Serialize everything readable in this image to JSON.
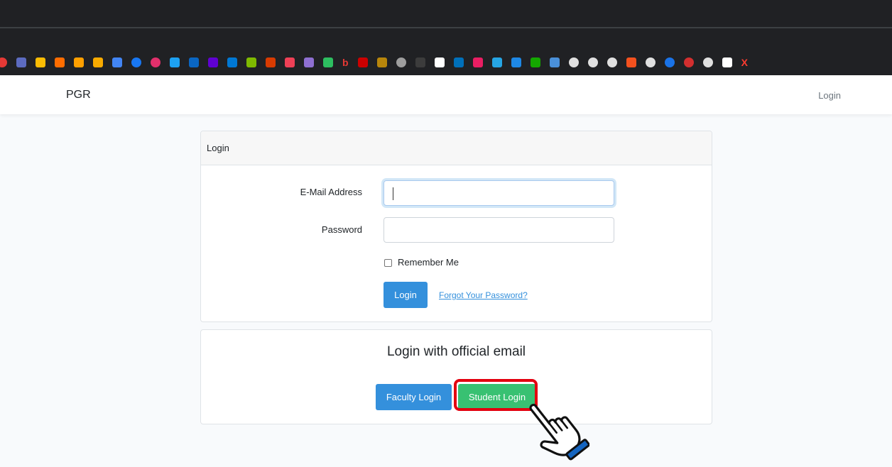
{
  "browser": {
    "bookmark_icons": [
      {
        "icon": "red-dot-icon",
        "color": "#e53935",
        "round": true
      },
      {
        "icon": "bookmark-flag-icon",
        "color": "#5c6bc0"
      },
      {
        "icon": "google-ads-icon",
        "color": "#fbbc04"
      },
      {
        "icon": "arch-icon",
        "color": "#ff6d00"
      },
      {
        "icon": "firebase-icon",
        "color": "#ffa000"
      },
      {
        "icon": "analytics-icon",
        "color": "#f9ab00"
      },
      {
        "icon": "translate-icon",
        "color": "#4285f4"
      },
      {
        "icon": "facebook-icon",
        "color": "#1877f2",
        "round": true
      },
      {
        "icon": "instagram-icon",
        "color": "#e1306c",
        "round": true
      },
      {
        "icon": "twitter-icon",
        "color": "#1da1f2"
      },
      {
        "icon": "linkedin-icon",
        "color": "#0a66c2"
      },
      {
        "icon": "yahoo-icon",
        "color": "#6001d2"
      },
      {
        "icon": "outlook-icon",
        "color": "#0078d4"
      },
      {
        "icon": "microsoft-icon",
        "color": "#7fba00"
      },
      {
        "icon": "office-icon",
        "color": "#d83b01"
      },
      {
        "icon": "pocket-icon",
        "color": "#ef4056"
      },
      {
        "icon": "notes-icon",
        "color": "#8e6fd1"
      },
      {
        "icon": "evernote-icon",
        "color": "#2dbe60"
      },
      {
        "icon": "text-b-icon",
        "color": "#e53935",
        "text": "b"
      },
      {
        "icon": "cnn-icon",
        "color": "#cc0000"
      },
      {
        "icon": "pattern-icon",
        "color": "#b8860b"
      },
      {
        "icon": "profile-icon",
        "color": "#9e9e9e",
        "round": true
      },
      {
        "icon": "drive-icon",
        "color": "#3c3c3c"
      },
      {
        "icon": "notion-icon",
        "color": "#ffffff"
      },
      {
        "icon": "paypal-icon",
        "color": "#0070ba"
      },
      {
        "icon": "s-icon",
        "color": "#e91e63"
      },
      {
        "icon": "drop-icon",
        "color": "#26a5e4"
      },
      {
        "icon": "y-icon",
        "color": "#1e88e5"
      },
      {
        "icon": "upwork-icon",
        "color": "#14a800"
      },
      {
        "icon": "four-icon",
        "color": "#4a90d9"
      },
      {
        "icon": "globe-icon",
        "color": "#e0e0e0",
        "round": true
      },
      {
        "icon": "globe-icon",
        "color": "#e0e0e0",
        "round": true
      },
      {
        "icon": "globe-icon",
        "color": "#e0e0e0",
        "round": true
      },
      {
        "icon": "pinwheel-icon",
        "color": "#f4511e"
      },
      {
        "icon": "globe-icon",
        "color": "#e0e0e0",
        "round": true
      },
      {
        "icon": "star-circle-icon",
        "color": "#1a73e8",
        "round": true
      },
      {
        "icon": "red-circle-icon",
        "color": "#d32f2f",
        "round": true
      },
      {
        "icon": "globe-icon",
        "color": "#e0e0e0",
        "round": true
      },
      {
        "icon": "tl-icon",
        "color": "#ffffff"
      },
      {
        "icon": "x-icon",
        "color": "#ff3b30",
        "text": "X"
      }
    ]
  },
  "navbar": {
    "brand": "PGR",
    "login_link": "Login"
  },
  "login_card": {
    "header": "Login",
    "email_label": "E-Mail Address",
    "email_value": "",
    "password_label": "Password",
    "password_value": "",
    "remember_label": "Remember Me",
    "login_button": "Login",
    "forgot_link": "Forgot Your Password?"
  },
  "official_card": {
    "title": "Login with official email",
    "faculty_button": "Faculty Login",
    "student_button": "Student Login"
  },
  "colors": {
    "primary": "#3490dc",
    "success": "#38c172",
    "highlight": "#e3000f"
  }
}
